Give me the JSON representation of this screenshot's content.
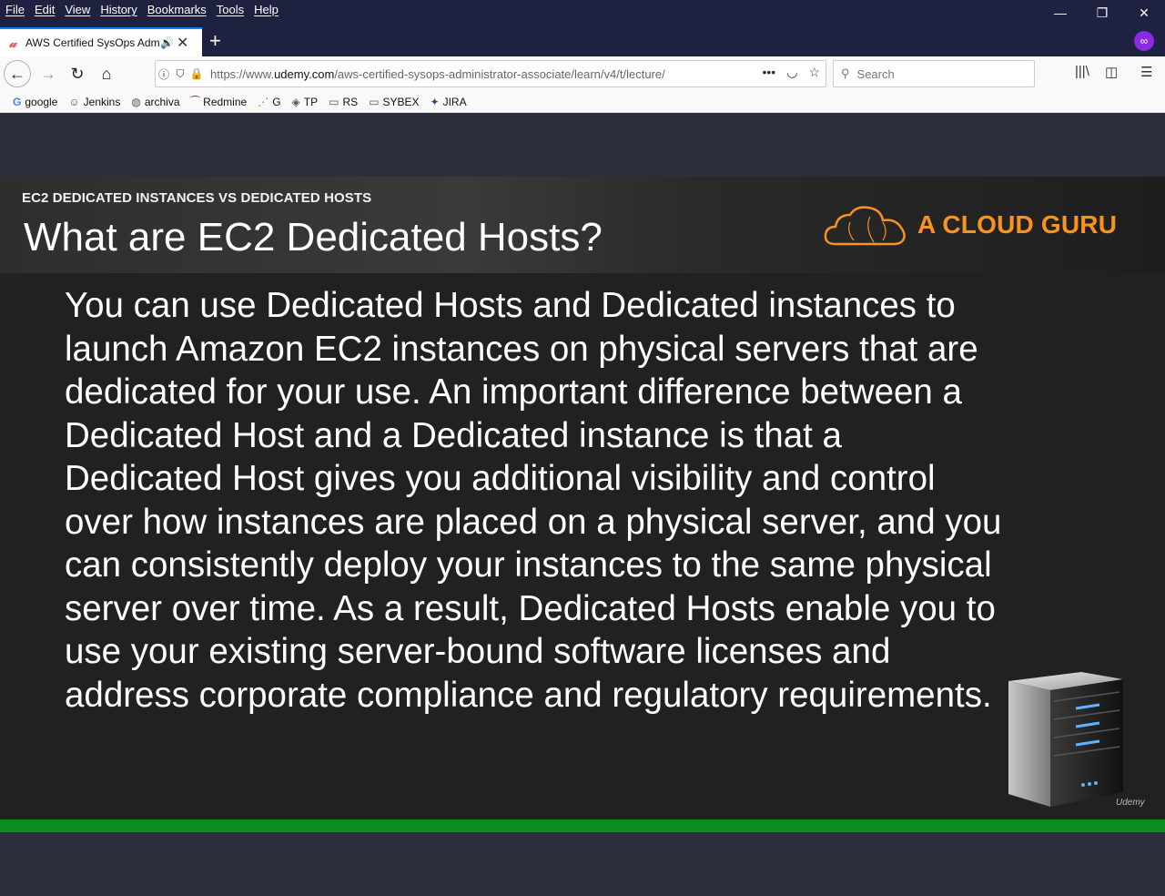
{
  "menubar": {
    "items": [
      "File",
      "Edit",
      "View",
      "History",
      "Bookmarks",
      "Tools",
      "Help"
    ]
  },
  "window_controls": {
    "minimize": "—",
    "restore": "❐",
    "close": "✕"
  },
  "tab": {
    "title": "AWS Certified SysOps Admi",
    "favicon": "𝓊",
    "sound": "🔊",
    "close": "✕"
  },
  "newtab": "+",
  "nav": {
    "back": "←",
    "forward": "→",
    "reload": "↻",
    "home": "⌂"
  },
  "urlbar": {
    "url_prefix": "https://www.",
    "url_domain": "udemy.com",
    "url_path": "/aws-certified-sysops-administrator-associate/learn/v4/t/lecture/",
    "more": "•••",
    "pocket": "◡",
    "star": "☆"
  },
  "search": {
    "placeholder": "Search",
    "icon": "search-icon"
  },
  "toolbar_icons": [
    "library-icon",
    "sidebar-icon",
    "menu-icon"
  ],
  "bookmarks": [
    {
      "label": "google",
      "icon": "G"
    },
    {
      "label": "Jenkins",
      "icon": "☺"
    },
    {
      "label": "archiva",
      "icon": "◍"
    },
    {
      "label": "Redmine",
      "icon": "⁀"
    },
    {
      "label": "G",
      "icon": "⋰"
    },
    {
      "label": "TP",
      "icon": "◈"
    },
    {
      "label": "RS",
      "icon": "▭"
    },
    {
      "label": "SYBEX",
      "icon": "▭"
    },
    {
      "label": "JIRA",
      "icon": "✦"
    }
  ],
  "slide": {
    "kicker": "EC2 DEDICATED INSTANCES VS DEDICATED HOSTS",
    "title": "What are EC2 Dedicated Hosts?",
    "brand": "A CLOUD GURU",
    "body": "You can use Dedicated Hosts and Dedicated instances to launch Amazon EC2 instances on physical servers that are dedicated for your use. An important difference between a Dedicated Host and a Dedicated instance is that a Dedicated Host gives you additional visibility and control over how instances are placed on a physical server, and you can consistently deploy your instances to the same physical server over time. As a result, Dedicated Hosts enable you to use your existing server-bound software licenses and address corporate compliance and regulatory requirements.",
    "watermark": "Udemy"
  },
  "colors": {
    "brand_orange": "#f7931e",
    "progress_green": "#0a8d1a",
    "tab_accent": "#0a84ff"
  }
}
